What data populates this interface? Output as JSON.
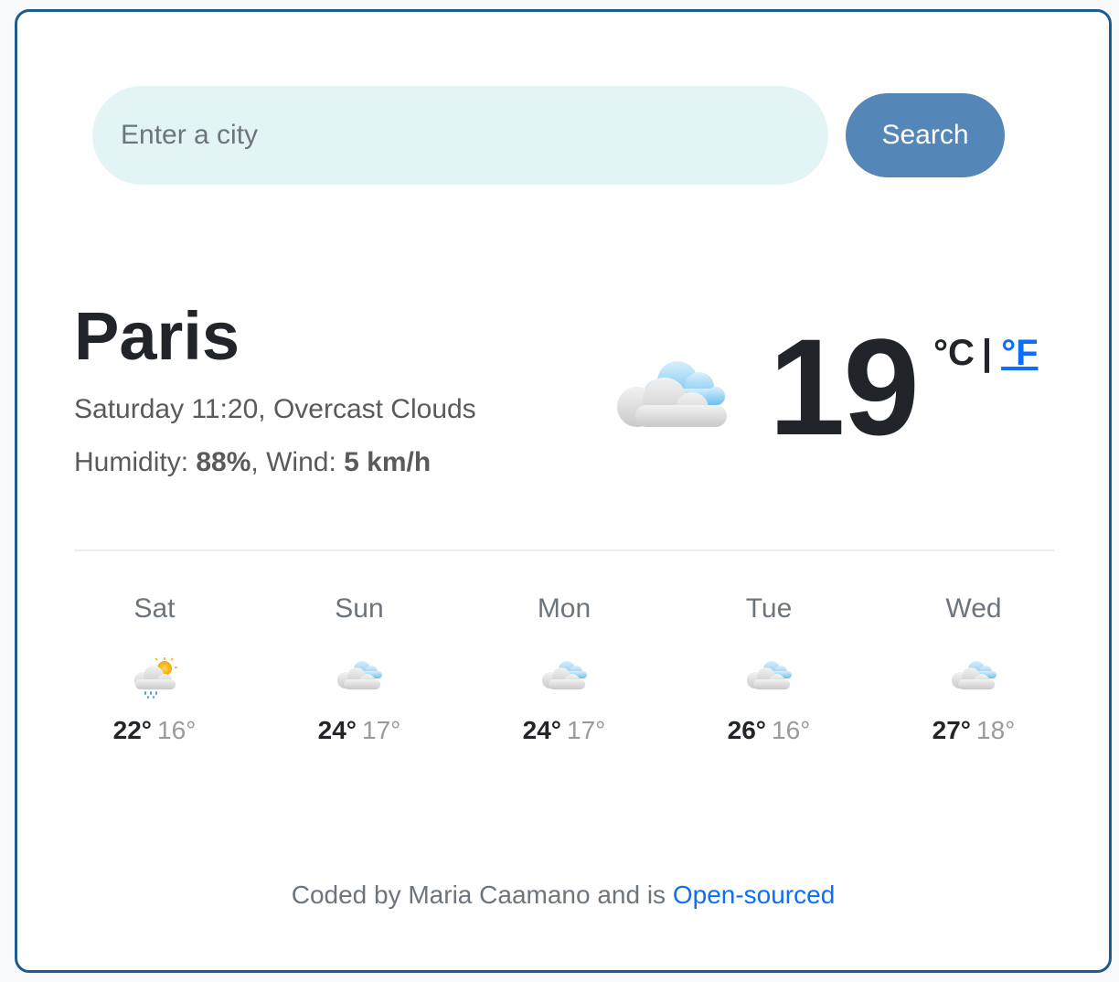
{
  "search": {
    "placeholder": "Enter a city",
    "button_label": "Search"
  },
  "current": {
    "city": "Paris",
    "day_time": "Saturday 11:20",
    "description": "Overcast Clouds",
    "humidity_label": "Humidity:",
    "humidity_value": "88%",
    "wind_label": "Wind:",
    "wind_value": "5 km/h",
    "temperature": "19",
    "unit_celsius": "°C",
    "unit_separator": "|",
    "unit_fahrenheit": "°F",
    "icon": "overcast-clouds-icon"
  },
  "forecast": [
    {
      "day": "Sat",
      "max": "22°",
      "min": "16°",
      "icon": "rain-sun-icon"
    },
    {
      "day": "Sun",
      "max": "24°",
      "min": "17°",
      "icon": "clouds-icon"
    },
    {
      "day": "Mon",
      "max": "24°",
      "min": "17°",
      "icon": "clouds-icon"
    },
    {
      "day": "Tue",
      "max": "26°",
      "min": "16°",
      "icon": "clouds-icon"
    },
    {
      "day": "Wed",
      "max": "27°",
      "min": "18°",
      "icon": "clouds-icon"
    }
  ],
  "footer": {
    "text": "Coded by Maria Caamano and is",
    "link_label": "Open-sourced"
  },
  "colors": {
    "frame_border": "#1c5d8e",
    "search_bg": "#e3f4f4",
    "button_bg": "#5586b8",
    "link": "#0d6efd"
  }
}
